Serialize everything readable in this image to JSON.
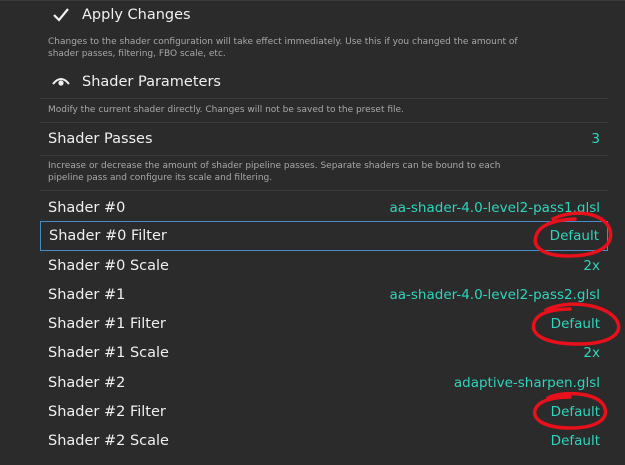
{
  "apply": {
    "title": "Apply Changes",
    "icon": "checkmark-icon",
    "description": "Changes to the shader configuration will take effect immediately. Use this if you changed the amount of shader passes, filtering, FBO scale, etc."
  },
  "params": {
    "title": "Shader Parameters",
    "icon": "eye-icon",
    "description": "Modify the current shader directly. Changes will not be saved to the preset file."
  },
  "passes": {
    "label": "Shader Passes",
    "value": "3",
    "description": "Increase or decrease the amount of shader pipeline passes. Separate shaders can be bound to each pipeline pass and configure its scale and filtering."
  },
  "items": [
    {
      "label": "Shader #0",
      "value": "aa-shader-4.0-level2-pass1.glsl"
    },
    {
      "label": "Shader #0 Filter",
      "value": "Default"
    },
    {
      "label": "Shader #0 Scale",
      "value": "2x"
    },
    {
      "label": "Shader #1",
      "value": "aa-shader-4.0-level2-pass2.glsl"
    },
    {
      "label": "Shader #1 Filter",
      "value": "Default"
    },
    {
      "label": "Shader #1 Scale",
      "value": "2x"
    },
    {
      "label": "Shader #2",
      "value": "adaptive-sharpen.glsl"
    },
    {
      "label": "Shader #2 Filter",
      "value": "Default"
    },
    {
      "label": "Shader #2 Scale",
      "value": "Default"
    }
  ],
  "colors": {
    "accent": "#2fd4bd",
    "selection": "#4a8cc7",
    "annotation": "#e8101a"
  }
}
